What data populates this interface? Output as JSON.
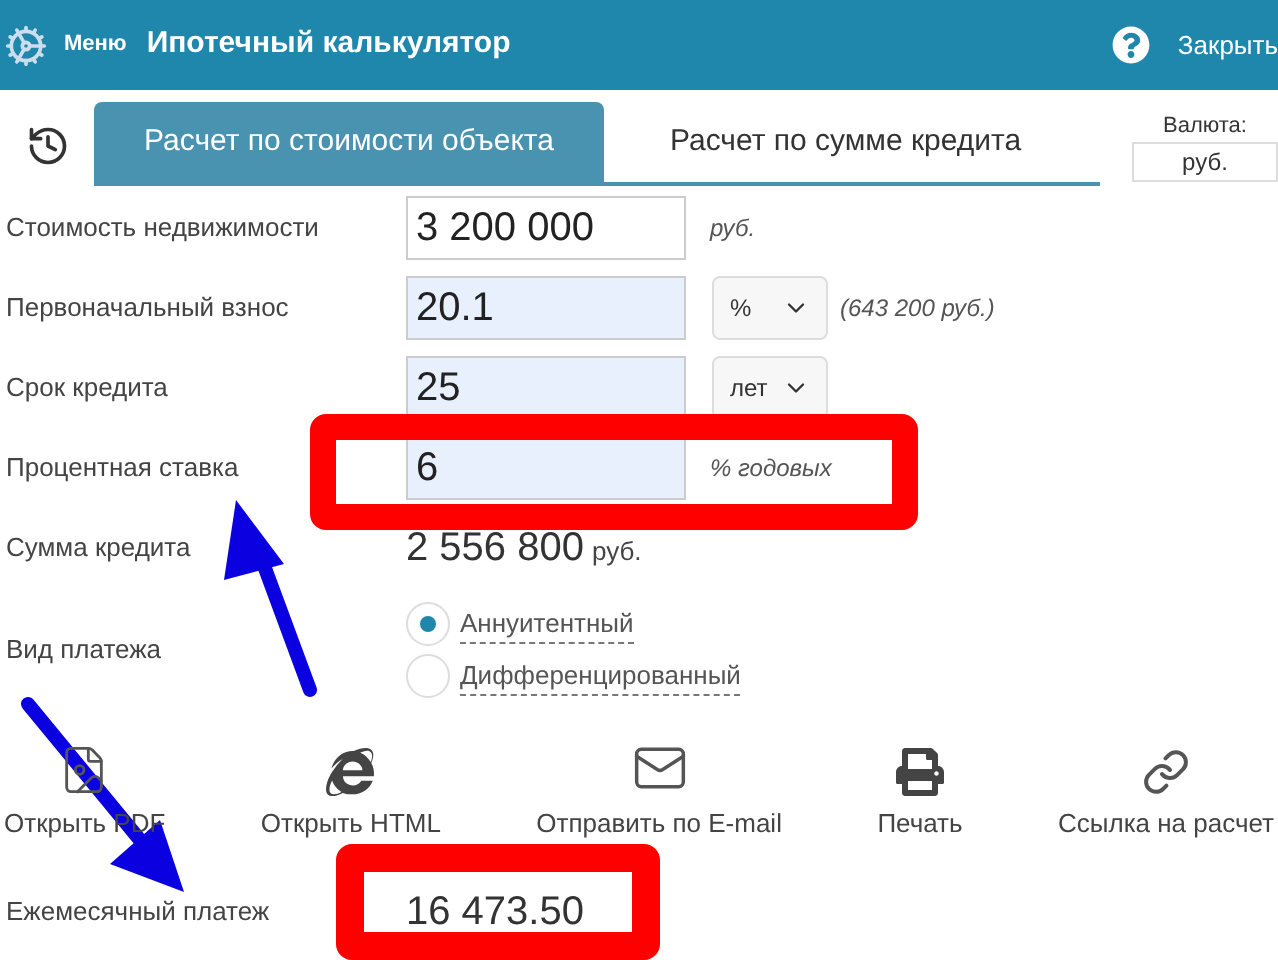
{
  "header": {
    "menu": "Меню",
    "title": "Ипотечный калькулятор",
    "close": "Закрыть"
  },
  "tabs": [
    {
      "label": "Расчет по стоимости объекта",
      "selected": true
    },
    {
      "label": "Расчет по сумме кредита",
      "selected": false
    }
  ],
  "currency": {
    "label": "Валюта:",
    "value": "руб."
  },
  "fields": [
    {
      "kind": "unit",
      "label": "Стоимость недвижимости",
      "value": "3 200 000",
      "unit": "руб.",
      "highlighted": false
    },
    {
      "kind": "select",
      "label": "Первоначальный взнос",
      "value": "20.1",
      "option": "%",
      "note": "(643 200 руб.)",
      "highlighted": true
    },
    {
      "kind": "select",
      "label": "Срок кредита",
      "value": "25",
      "option": "лет",
      "highlighted": true
    },
    {
      "kind": "unit",
      "label": "Процентная ставка",
      "value": "6",
      "unit": "% годовых",
      "highlighted": true
    },
    {
      "kind": "result",
      "label": "Сумма кредита",
      "value": "2 556 800",
      "unit": "руб."
    }
  ],
  "payment_type": {
    "label": "Вид платежа",
    "options": [
      {
        "label": "Аннуитентный",
        "selected": true
      },
      {
        "label": "Дифференцированный",
        "selected": false
      }
    ]
  },
  "actions": [
    {
      "kind": "pdf",
      "label": "Открыть PDF"
    },
    {
      "kind": "html",
      "label": "Открыть HTML"
    },
    {
      "kind": "email",
      "label": "Отправить по E-mail"
    },
    {
      "kind": "print",
      "label": "Печать"
    },
    {
      "kind": "link",
      "label": "Ссылка на расчет"
    }
  ],
  "monthly_payment": {
    "label": "Ежемесячный платеж",
    "value": "16 473.50"
  }
}
